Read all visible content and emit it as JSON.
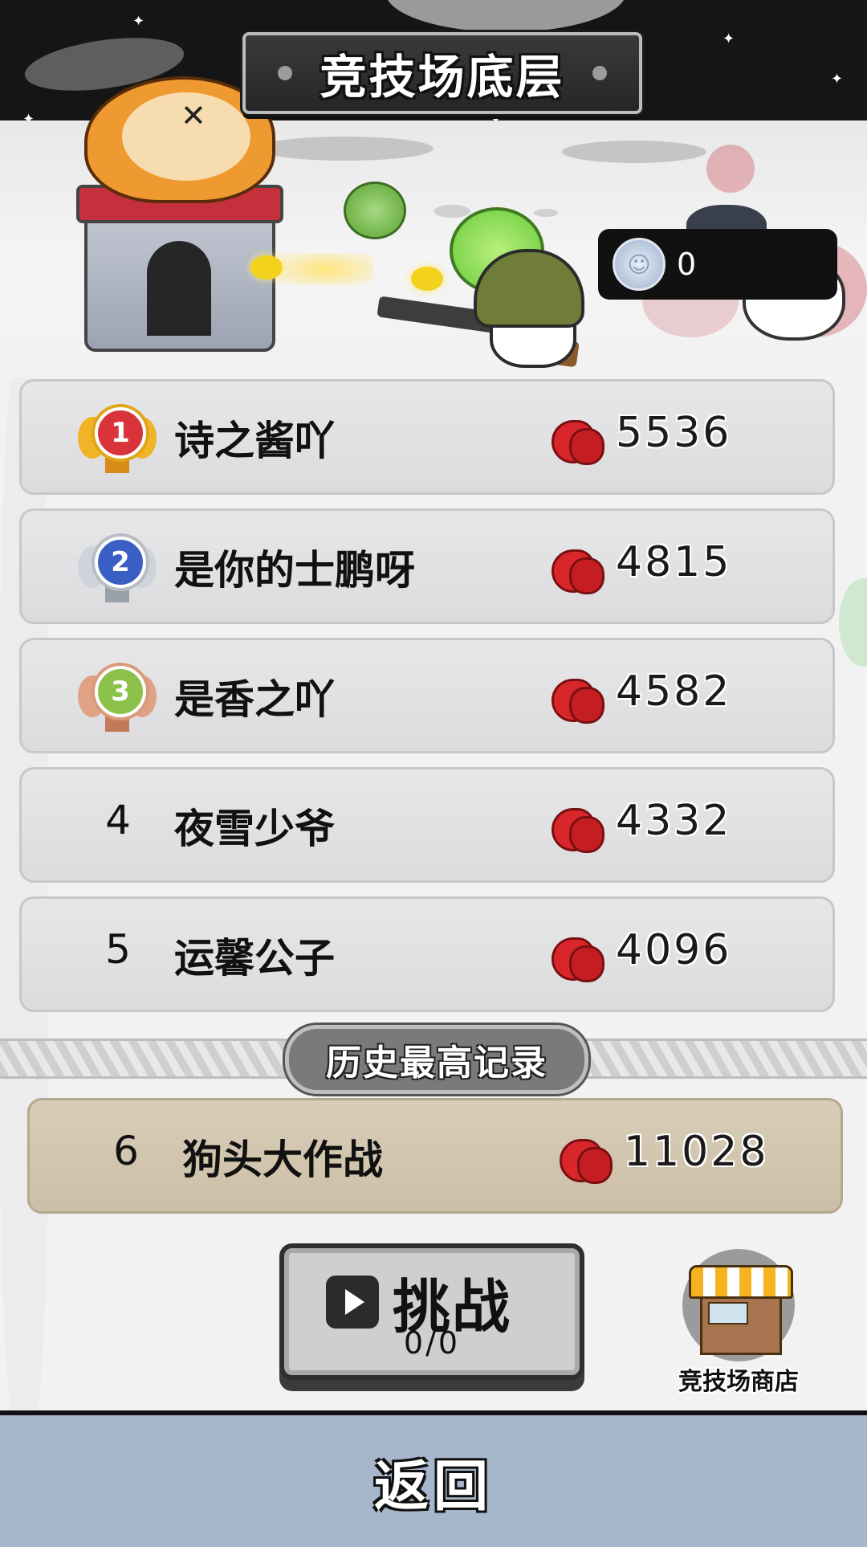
{
  "title": "竞技场底层",
  "coins": {
    "value": "0"
  },
  "leaderboard": [
    {
      "rank": "1",
      "name": "诗之酱吖",
      "score": "5536",
      "medal": "gold"
    },
    {
      "rank": "2",
      "name": "是你的士鹏呀",
      "score": "4815",
      "medal": "silver"
    },
    {
      "rank": "3",
      "name": "是香之吖",
      "score": "4582",
      "medal": "bronze"
    },
    {
      "rank": "4",
      "name": "夜雪少爷",
      "score": "4332"
    },
    {
      "rank": "5",
      "name": "运馨公子",
      "score": "4096"
    }
  ],
  "history": {
    "label": "历史最高记录",
    "rank": "6",
    "name": "狗头大作战",
    "score": "11028"
  },
  "challenge": {
    "label": "挑战",
    "count": "0/0"
  },
  "shop": {
    "label": "竞技场商店"
  },
  "back": {
    "label": "返回"
  },
  "colors": {
    "gold_medal": "#d8343a",
    "silver_medal": "#3a5fc4",
    "bronze_medal": "#8dc24a",
    "glove": "#d9262b",
    "bottom_bar": "#a6b6cb"
  }
}
